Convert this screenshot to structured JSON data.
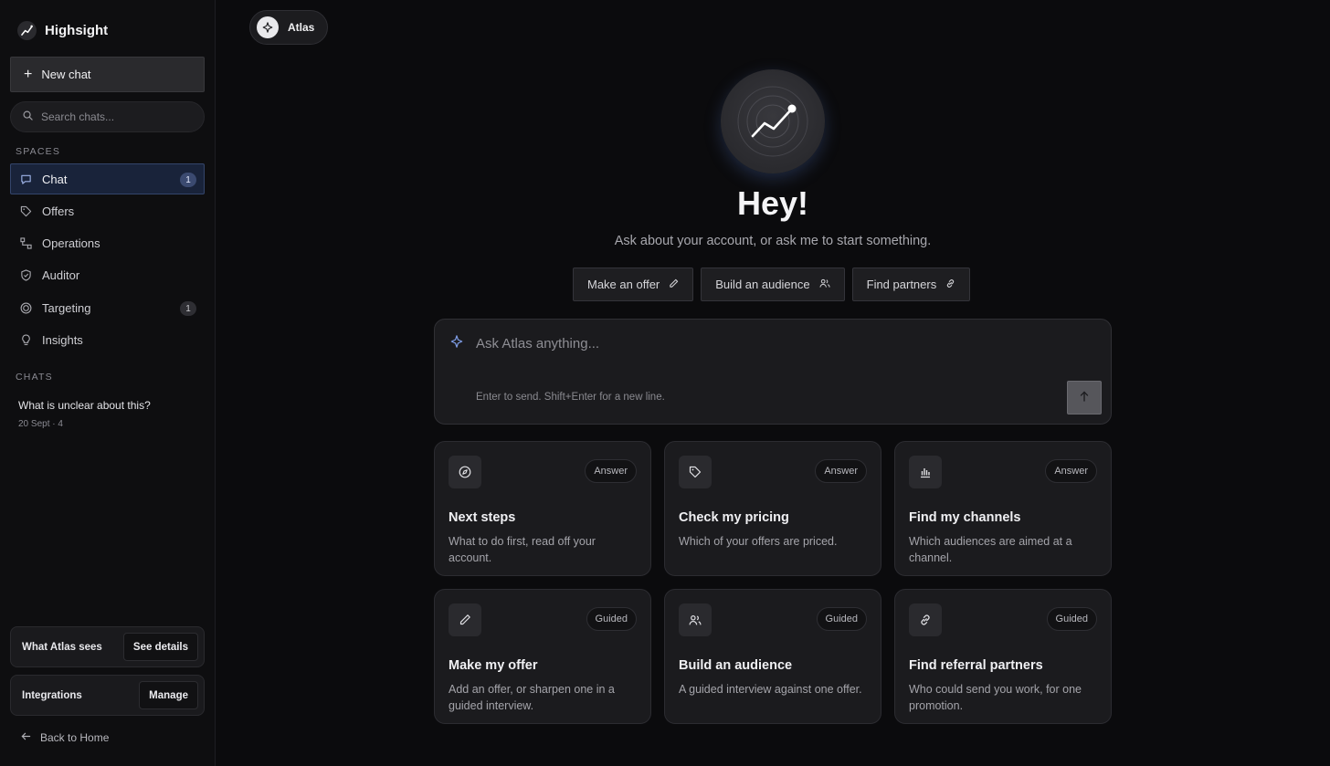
{
  "brand": {
    "name": "Highsight"
  },
  "sidebar": {
    "new_chat": "New chat",
    "search_placeholder": "Search chats...",
    "spaces_label": "SPACES",
    "items": [
      {
        "label": "Chat",
        "badge": "1",
        "active": true,
        "icon": "chat-bubble-icon"
      },
      {
        "label": "Offers",
        "badge": "",
        "icon": "tag-icon"
      },
      {
        "label": "Operations",
        "badge": "",
        "icon": "flow-icon"
      },
      {
        "label": "Auditor",
        "badge": "",
        "icon": "shield-check-icon"
      },
      {
        "label": "Targeting",
        "badge": "1",
        "icon": "target-icon"
      },
      {
        "label": "Insights",
        "badge": "",
        "icon": "lightbulb-icon"
      }
    ],
    "chats_label": "CHATS",
    "chats": [
      {
        "title": "What is unclear about this?",
        "meta": "20 Sept · 4"
      }
    ],
    "atlas_sees": {
      "label": "What Atlas sees",
      "button": "See details"
    },
    "integrations": {
      "label": "Integrations",
      "button": "Manage"
    },
    "back": "Back to Home"
  },
  "main": {
    "assistant_pill": "Atlas",
    "title": "Hey!",
    "subtitle": "Ask about your account, or ask me to start something.",
    "quick_actions": [
      {
        "label": "Make an offer",
        "icon": "pencil-icon"
      },
      {
        "label": "Build an audience",
        "icon": "users-icon"
      },
      {
        "label": "Find partners",
        "icon": "link-icon"
      }
    ],
    "composer": {
      "placeholder": "Ask Atlas anything...",
      "hint": "Enter to send. Shift+Enter for a new line."
    },
    "cards": [
      {
        "title": "Next steps",
        "desc": "What to do first, read off your account.",
        "tag": "Answer",
        "icon": "compass-icon"
      },
      {
        "title": "Check my pricing",
        "desc": "Which of your offers are priced.",
        "tag": "Answer",
        "icon": "tag-icon"
      },
      {
        "title": "Find my channels",
        "desc": "Which audiences are aimed at a channel.",
        "tag": "Answer",
        "icon": "bar-chart-icon"
      },
      {
        "title": "Make my offer",
        "desc": "Add an offer, or sharpen one in a guided interview.",
        "tag": "Guided",
        "icon": "pencil-icon"
      },
      {
        "title": "Build an audience",
        "desc": "A guided interview against one offer.",
        "tag": "Guided",
        "icon": "users-icon"
      },
      {
        "title": "Find referral partners",
        "desc": "Who could send you work, for one promotion.",
        "tag": "Guided",
        "icon": "link-icon"
      }
    ]
  },
  "colors": {
    "accent": "#34456b",
    "background": "#0b0b0d"
  }
}
